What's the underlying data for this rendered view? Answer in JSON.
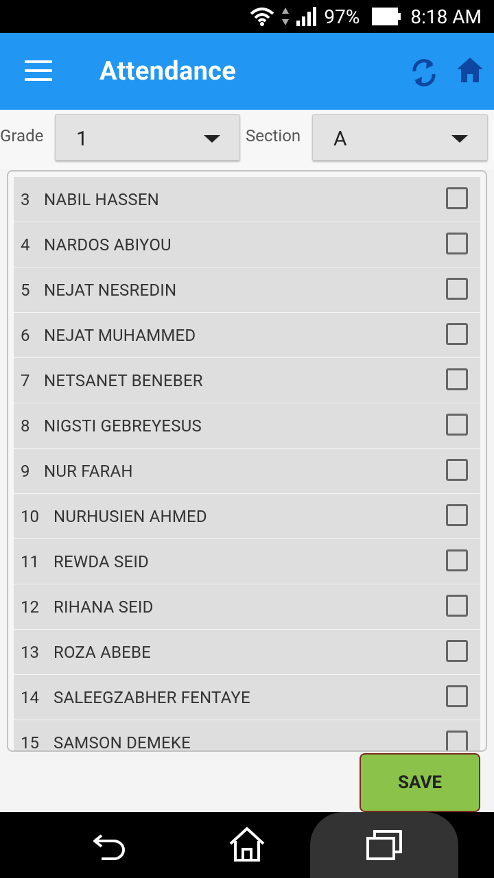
{
  "status_bar": {
    "battery_percent": "97%",
    "time": "8:18 AM"
  },
  "app_bar": {
    "title": "Attendance",
    "icons": [
      "menu-icon",
      "refresh-icon",
      "home-icon"
    ]
  },
  "filters": {
    "grade_label": "Grade",
    "grade_value": "1",
    "section_label": "Section",
    "section_value": "A"
  },
  "students": [
    {
      "num": "3",
      "name": "NABIL HASSEN",
      "present": false
    },
    {
      "num": "4",
      "name": "NARDOS ABIYOU",
      "present": false
    },
    {
      "num": "5",
      "name": "NEJAT NESREDIN",
      "present": false
    },
    {
      "num": "6",
      "name": "NEJAT MUHAMMED",
      "present": false
    },
    {
      "num": "7",
      "name": "NETSANET BENEBER",
      "present": false
    },
    {
      "num": "8",
      "name": "NIGSTI GEBREYESUS",
      "present": false
    },
    {
      "num": "9",
      "name": "NUR FARAH",
      "present": false
    },
    {
      "num": "10",
      "name": "NURHUSIEN AHMED",
      "present": false
    },
    {
      "num": "11",
      "name": "REWDA SEID",
      "present": false
    },
    {
      "num": "12",
      "name": "RIHANA SEID",
      "present": false
    },
    {
      "num": "13",
      "name": "ROZA ABEBE",
      "present": false
    },
    {
      "num": "14",
      "name": "SALEEGZABHER FENTAYE",
      "present": false
    },
    {
      "num": "15",
      "name": "SAMSON DEMEKE",
      "present": false
    }
  ],
  "save_label": "SAVE",
  "colors": {
    "app_bar": "#2196f3",
    "save_button": "#8bc34a",
    "row_bg": "#dedede"
  },
  "nav_bar": {
    "icons": [
      "back-icon",
      "home-nav-icon",
      "recent-apps-icon"
    ]
  }
}
